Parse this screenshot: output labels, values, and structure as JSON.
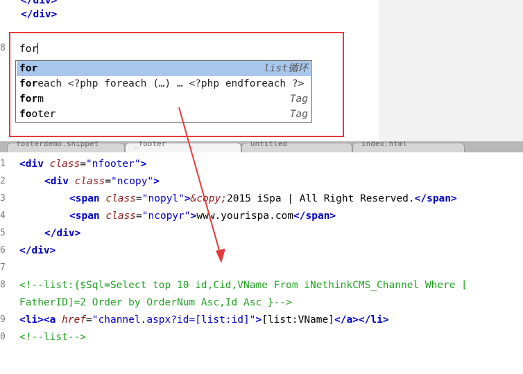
{
  "top_editor": {
    "lines": [
      {
        "num": "",
        "text": "</div>"
      },
      {
        "num": "",
        "text": "</div>"
      },
      {
        "num": "8",
        "text": "for"
      }
    ]
  },
  "autocomplete": {
    "items": [
      {
        "bold": "for",
        "rest": "",
        "desc": "list循环",
        "selected": true
      },
      {
        "bold": "for",
        "rest": "each <?php foreach (…) … <?php endforeach ?>",
        "desc": "",
        "selected": false
      },
      {
        "bold": "for",
        "rest": "m",
        "desc": "Tag",
        "selected": false
      },
      {
        "bold": "fo",
        "rest": "oter",
        "desc": "Tag",
        "selected": false
      }
    ]
  },
  "tabs": [
    {
      "label": "footerdemo.snippet"
    },
    {
      "label": "_footer"
    },
    {
      "label": "untitled"
    },
    {
      "label": "index.html"
    }
  ],
  "bottom_editor": {
    "line_numbers": [
      "1",
      "2",
      "3",
      "4",
      "5",
      "6",
      "7",
      "8",
      "",
      "9",
      "0"
    ],
    "line1": {
      "open": "<div ",
      "attr": "class",
      "eq": "=",
      "val": "\"nfooter\"",
      "close": ">"
    },
    "line2": {
      "open": "<div ",
      "attr": "class",
      "eq": "=",
      "val": "\"ncopy\"",
      "close": ">"
    },
    "line3": {
      "open": "<span ",
      "attr": "class",
      "eq": "=",
      "val": "\"nopyl\"",
      "close": ">",
      "entity": "&copy;",
      "text": "2015 iSpa | All Right Reserved.",
      "end": "</span>"
    },
    "line4": {
      "open": "<span ",
      "attr": "class",
      "eq": "=",
      "val": "\"ncopyr\"",
      "close": ">",
      "text": "www.yourispa.com",
      "end": "</span>"
    },
    "line5": "</div>",
    "line6": "</div>",
    "line8a": "<!--list:{$Sql=Select top 10 id,Cid,VName From iNethinkCMS_Channel Where [",
    "line8b": "FatherID]=2 Order by OrderNum Asc,Id Asc }-->",
    "line9": {
      "li": "<li>",
      "a_open": "<a ",
      "attr": "href",
      "eq": "=",
      "val": "\"channel.aspx?id=[list:id]\"",
      "close": ">",
      "text": "[list:VName]",
      "a_end": "</a>",
      "li_end": "</li>"
    },
    "line10": "<!--list-->"
  },
  "colors": {
    "highlight": "#e53a3a",
    "arrow": "#e53a3a",
    "selection": "#a9c6ec"
  }
}
